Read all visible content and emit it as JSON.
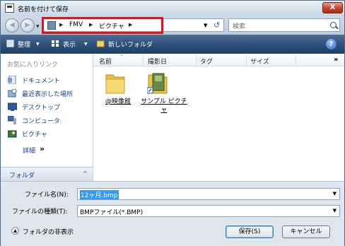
{
  "window": {
    "title": "名前を付けて保存",
    "close_label": "X"
  },
  "address": {
    "breadcrumbs": [
      "FMV",
      "ピクチャ"
    ],
    "search_placeholder": "検索"
  },
  "toolbar": {
    "organize_label": "整理",
    "views_label": "表示",
    "new_folder_label": "新しいフォルダ",
    "help_label": "?"
  },
  "sidebar": {
    "favorites_title": "お気に入りリンク",
    "items": [
      {
        "label": "ドキュメント",
        "icon": "documents-icon"
      },
      {
        "label": "最近表示した場所",
        "icon": "recent-places-icon"
      },
      {
        "label": "デスクトップ",
        "icon": "desktop-icon"
      },
      {
        "label": "コンピュータ",
        "icon": "computer-icon"
      },
      {
        "label": "ピクチャ",
        "icon": "pictures-icon"
      }
    ],
    "more_label": "詳細",
    "more_arrows": "»",
    "folders_label": "フォルダ",
    "folders_chevron": "^"
  },
  "columns": [
    "名前",
    "撮影日",
    "タグ",
    "サイズ"
  ],
  "columns_more": "»",
  "files": [
    {
      "label": "@映像館"
    },
    {
      "label": "サンプル ピクチャ"
    }
  ],
  "form": {
    "filename_label": "ファイル名(N):",
    "filename_value": "12ヶ月.bmp",
    "filetype_label": "ファイルの種類(T):",
    "filetype_value": "BMPファイル(*.BMP)",
    "hide_folders_label": "フォルダの非表示",
    "save_label": "保存(S)",
    "cancel_label": "キャンセル"
  },
  "colors": {
    "highlight_border": "#e0141e",
    "toolbar_bg": "#2d4f78",
    "selection": "#3399ff"
  }
}
